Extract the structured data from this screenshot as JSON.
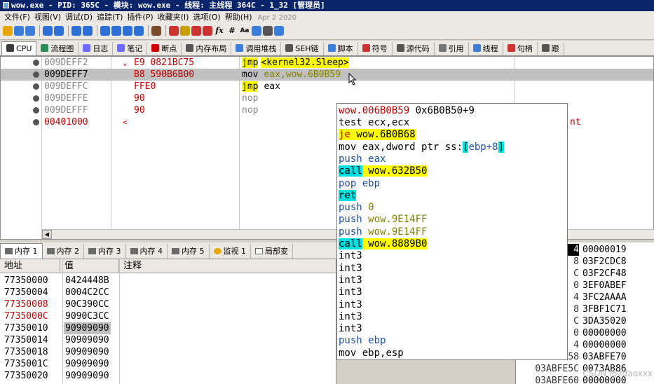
{
  "title": {
    "text": "wow.exe - PID: 365C - 模块: wow.exe - 线程: 主线程 364C - 1_32 [管理员]"
  },
  "menu": {
    "items": [
      "文件(F)",
      "视图(V)",
      "调试(D)",
      "追踪(T)",
      "插件(P)",
      "收藏夹(I)",
      "选项(O)",
      "帮助(H)"
    ],
    "date": "Apr 2 2020"
  },
  "toolbar": {
    "icons": [
      "open-icon",
      "restart-icon",
      "close-icon",
      "run-icon",
      "pause-icon",
      "step-into-icon",
      "step-over-icon",
      "trace-into-icon",
      "trace-over-icon",
      "run-to-user-icon",
      "animate-icon",
      "script-icon",
      "patch-icon",
      "comment-icon",
      "label-icon",
      "bookmark-icon",
      "function-icon",
      "hash-icon",
      "font-icon",
      "memory-icon",
      "calculator-icon",
      "settings-icon"
    ],
    "fx_label": "fx",
    "hash_label": "#",
    "font_label": "Aa"
  },
  "view_tabs": [
    "CPU",
    "流程图",
    "日志",
    "笔记",
    "断点",
    "内存布局",
    "调用堆栈",
    "SEH链",
    "脚本",
    "符号",
    "源代码",
    "引用",
    "线程",
    "句柄",
    "跟"
  ],
  "disasm": [
    {
      "addr": "009DEFF2",
      "arrow": "⌄",
      "bytes": "E9 0821BC75",
      "mnem": "jmp",
      "operand": "<kernel32.Sleep>",
      "style": "jmp"
    },
    {
      "addr": "009DEFF7",
      "arrow": "",
      "bytes": "B8 590B6B00",
      "mnem": "mov",
      "operand": "eax,wow.6B0B59",
      "style": "mov",
      "selected": true
    },
    {
      "addr": "009DEFFC",
      "arrow": "",
      "bytes": "FFE0",
      "mnem": "jmp",
      "operand": "eax",
      "style": "jmpreg"
    },
    {
      "addr": "009DEFFE",
      "arrow": "",
      "bytes": "90",
      "mnem": "nop",
      "operand": "",
      "style": "nop"
    },
    {
      "addr": "009DEFFF",
      "arrow": "",
      "bytes": "90",
      "mnem": "nop",
      "operand": "",
      "style": "nop"
    },
    {
      "addr": "00401000",
      "arrow": "<",
      "bytes": "",
      "mnem": "",
      "operand": "",
      "style": "red",
      "trailing": "nt"
    }
  ],
  "mem_tabs": [
    "内存 1",
    "内存 2",
    "内存 3",
    "内存 4",
    "内存 5",
    "监视 1",
    "局部变"
  ],
  "dump": {
    "headers": {
      "addr": "地址",
      "value": "值",
      "comment": "注释"
    },
    "rows": [
      {
        "addr": "77350000",
        "value": "0424448B",
        "red": false
      },
      {
        "addr": "77350004",
        "value": "0004C2CC",
        "red": false
      },
      {
        "addr": "77350008",
        "value": "90C390CC",
        "red": true
      },
      {
        "addr": "7735000C",
        "value": "9090C3CC",
        "red": true
      },
      {
        "addr": "77350010",
        "value": "90909090",
        "red": false,
        "selected": true
      },
      {
        "addr": "77350014",
        "value": "90909090",
        "red": false
      },
      {
        "addr": "77350018",
        "value": "90909090",
        "red": false
      },
      {
        "addr": "7735001C",
        "value": "90909090",
        "red": false
      },
      {
        "addr": "77350020",
        "value": "90909090",
        "red": false
      }
    ]
  },
  "stack": {
    "rows": [
      {
        "addr": "4",
        "value": "00000019",
        "selected": true
      },
      {
        "addr": "8",
        "value": "03F2CDC8"
      },
      {
        "addr": "C",
        "value": "03F2CF48"
      },
      {
        "addr": "0",
        "value": "3EF0ABEF"
      },
      {
        "addr": "4",
        "value": "3FC2AAAA"
      },
      {
        "addr": "8",
        "value": "3FBF1C71"
      },
      {
        "addr": "C",
        "value": "3DA35020"
      },
      {
        "addr": "0",
        "value": "00000000"
      },
      {
        "addr": "4",
        "value": "00000000"
      },
      {
        "addr": "03ABFE58",
        "value": "03ABFE70"
      },
      {
        "addr": "03ABFE5C",
        "value": "0073AB86"
      },
      {
        "addr": "03ABFE60",
        "value": "00000000"
      }
    ]
  },
  "popup": {
    "header_label": "wow.006B0B59",
    "header_offset": "0x6B0B50+9",
    "lines": [
      {
        "a": "test",
        "b": " ecx,ecx",
        "style": "plain"
      },
      {
        "a": "je",
        "b": " wow.6B0B68",
        "style": "je"
      },
      {
        "a": "mov",
        "b": " eax,dword ptr ss:",
        "c": "[",
        "d": "ebp+8",
        "e": "]",
        "style": "movmem"
      },
      {
        "a": "push",
        "b": " eax",
        "style": "push"
      },
      {
        "a": "call",
        "b": " wow.632B50",
        "style": "call"
      },
      {
        "a": "pop",
        "b": " ebp",
        "style": "push"
      },
      {
        "a": "ret",
        "b": "",
        "style": "ret"
      },
      {
        "a": "push",
        "b": " 0",
        "style": "pushnum"
      },
      {
        "a": "push",
        "b": " wow.9E14FF",
        "style": "pushaddr"
      },
      {
        "a": "push",
        "b": " wow.9E14FF",
        "style": "pushaddr"
      },
      {
        "a": "call",
        "b": " wow.8889B0",
        "style": "call"
      },
      {
        "a": "int3",
        "b": "",
        "style": "plain"
      },
      {
        "a": "int3",
        "b": "",
        "style": "plain"
      },
      {
        "a": "int3",
        "b": "",
        "style": "plain"
      },
      {
        "a": "int3",
        "b": "",
        "style": "plain"
      },
      {
        "a": "int3",
        "b": "",
        "style": "plain"
      },
      {
        "a": "int3",
        "b": "",
        "style": "plain"
      },
      {
        "a": "int3",
        "b": "",
        "style": "plain"
      },
      {
        "a": "push",
        "b": " ebp",
        "style": "push"
      },
      {
        "a": "mov",
        "b": " ebp,esp",
        "style": "plain"
      }
    ]
  },
  "watermark": "CSDN @zdaoxxx"
}
